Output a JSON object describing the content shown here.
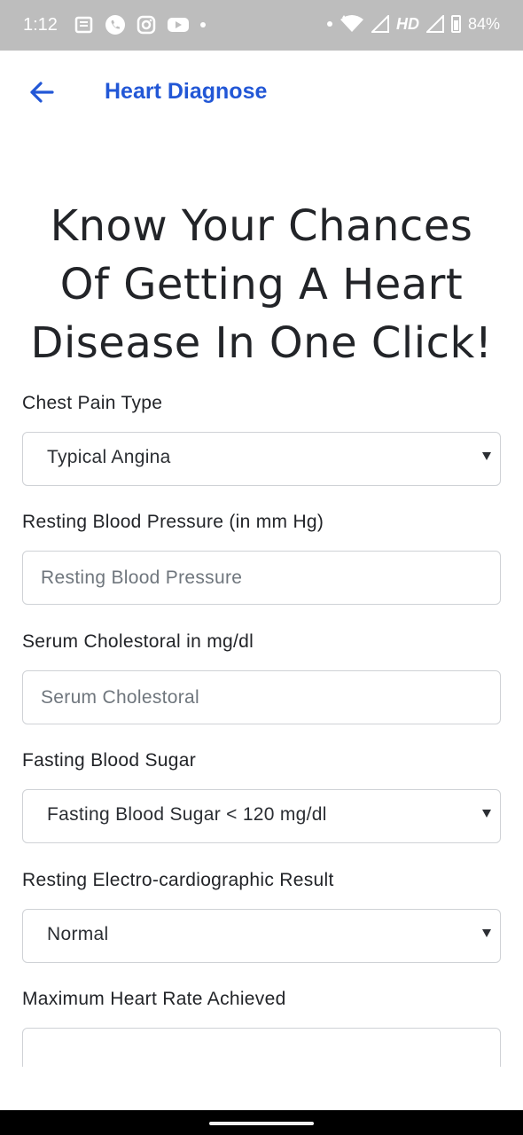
{
  "status_bar": {
    "time": "1:12",
    "battery": "84%",
    "network": "HD"
  },
  "app_bar": {
    "title": "Heart Diagnose",
    "accent_color": "#2257d6"
  },
  "hero": {
    "line1": "Know Your Chances",
    "line2": "Of Getting A Heart",
    "line3": "Disease In One Click!"
  },
  "form": {
    "chest_pain": {
      "label": "Chest Pain Type",
      "value": "Typical Angina"
    },
    "resting_bp": {
      "label": "Resting Blood Pressure (in mm Hg)",
      "placeholder": "Resting Blood Pressure"
    },
    "cholesterol": {
      "label": "Serum Cholestoral in mg/dl",
      "placeholder": "Serum Cholestoral"
    },
    "fasting_sugar": {
      "label": "Fasting Blood Sugar",
      "value": "Fasting Blood Sugar < 120 mg/dl"
    },
    "ecg": {
      "label": "Resting Electro-cardiographic Result",
      "value": "Normal"
    },
    "max_heart_rate": {
      "label": "Maximum Heart Rate Achieved",
      "placeholder": ""
    }
  }
}
